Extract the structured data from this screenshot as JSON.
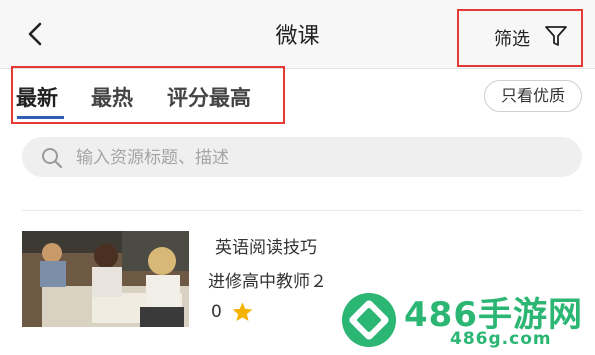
{
  "header": {
    "title": "微课",
    "filter_label": "筛选"
  },
  "tabs": [
    {
      "label": "最新",
      "active": true
    },
    {
      "label": "最热",
      "active": false
    },
    {
      "label": "评分最高",
      "active": false
    }
  ],
  "quality_button": "只看优质",
  "search": {
    "placeholder": "输入资源标题、描述"
  },
  "courses": [
    {
      "title": "英语阅读技巧",
      "teacher": "进修高中教师２",
      "score": "0"
    }
  ],
  "watermark": {
    "brand": "486手游网",
    "site": "486g.com"
  },
  "colors": {
    "accent": "#2f5fb3",
    "highlight_border": "#e53935",
    "star": "#f5b301",
    "watermark": "#2bb673"
  },
  "icons": [
    "back-icon",
    "filter-icon",
    "search-icon",
    "star-icon"
  ]
}
